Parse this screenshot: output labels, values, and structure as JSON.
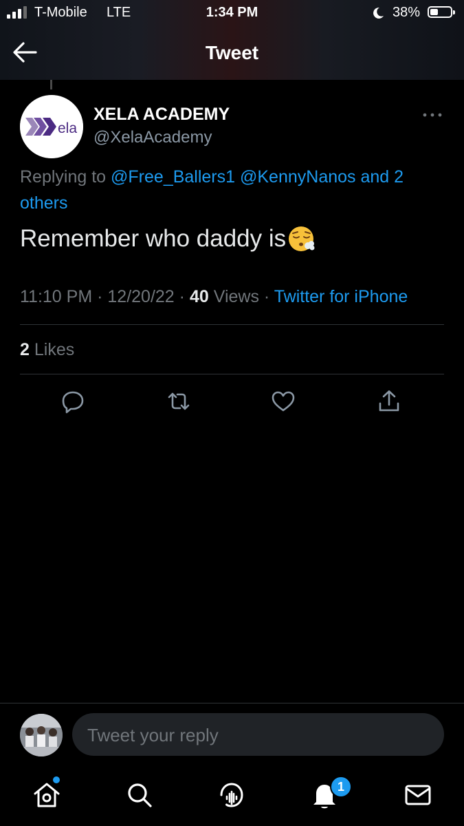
{
  "status_bar": {
    "carrier": "T-Mobile",
    "network": "LTE",
    "time": "1:34 PM",
    "battery_percent": "38%",
    "battery_level": 0.38,
    "icons": [
      "signal-icon",
      "moon-icon",
      "battery-icon"
    ]
  },
  "header": {
    "title": "Tweet",
    "back_icon": "arrow-left-icon"
  },
  "tweet": {
    "author_name": "XELA ACADEMY",
    "author_handle": "@XelaAcademy",
    "avatar_logo_text": "Xela",
    "replying_prefix": "Replying to",
    "mention_1": "@Free_Ballers1",
    "mention_2": "@KennyNanos",
    "mention_more": "and 2 others",
    "text": "Remember who daddy is",
    "emoji": "face-exhaling-emoji",
    "time": "11:10 PM",
    "date": "12/20/22",
    "views_count": "40",
    "views_label": "Views",
    "source": "Twitter for iPhone",
    "likes_count": "2",
    "likes_label": "Likes"
  },
  "actions": [
    "reply-icon",
    "retweet-icon",
    "like-icon",
    "share-icon"
  ],
  "reply_bar": {
    "placeholder": "Tweet your reply"
  },
  "tab_bar": {
    "tabs": [
      "home-icon",
      "search-icon",
      "spaces-icon",
      "notifications-icon",
      "messages-icon"
    ],
    "notifications_badge": "1"
  },
  "colors": {
    "background": "#000000",
    "accent": "#1d9bf0",
    "secondary_text": "#71767b",
    "brand_purple": "#5b2d8e"
  }
}
